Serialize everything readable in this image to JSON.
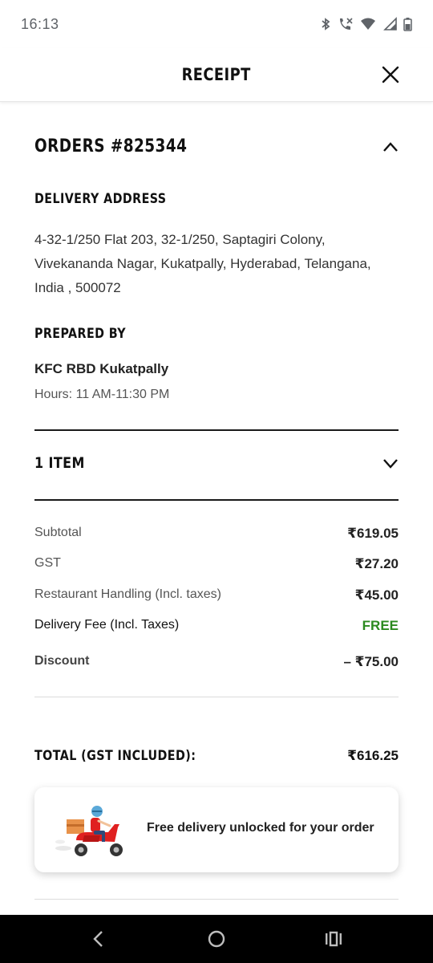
{
  "status_bar": {
    "time": "16:13"
  },
  "header": {
    "title": "RECEIPT"
  },
  "order": {
    "title": "ORDERS #825344"
  },
  "delivery": {
    "label": "DELIVERY ADDRESS",
    "line1": "4-32-1/250 Flat 203, 32-1/250, Saptagiri Colony,",
    "line2": "Vivekananda Nagar, Kukatpally, Hyderabad, Telangana,",
    "line3": "India , 500072"
  },
  "prepared": {
    "label": "PREPARED BY",
    "store": "KFC RBD Kukatpally",
    "hours": "Hours: 11 AM-11:30 PM"
  },
  "items": {
    "label": "1 ITEM"
  },
  "summary": {
    "subtotal_label": "Subtotal",
    "subtotal_value": "₹619.05",
    "gst_label": "GST",
    "gst_value": "₹27.20",
    "handling_label": "Restaurant Handling (Incl. taxes)",
    "handling_value": "₹45.00",
    "delivery_label": "Delivery Fee (Incl. Taxes)",
    "delivery_value": "FREE",
    "discount_label": "Discount",
    "discount_value": "– ₹75.00"
  },
  "total": {
    "label": "TOTAL (GST INCLUDED):",
    "value": "₹616.25"
  },
  "promo": {
    "text": "Free delivery unlocked for your order"
  },
  "colors": {
    "free_green": "#2b8a1f",
    "scooter_red": "#e02020"
  },
  "icons": {
    "close": "close-icon",
    "collapse": "chevron-up-icon",
    "expand": "chevron-down-icon",
    "nav_back": "back-icon",
    "nav_home": "home-icon",
    "nav_recents": "recents-icon"
  }
}
